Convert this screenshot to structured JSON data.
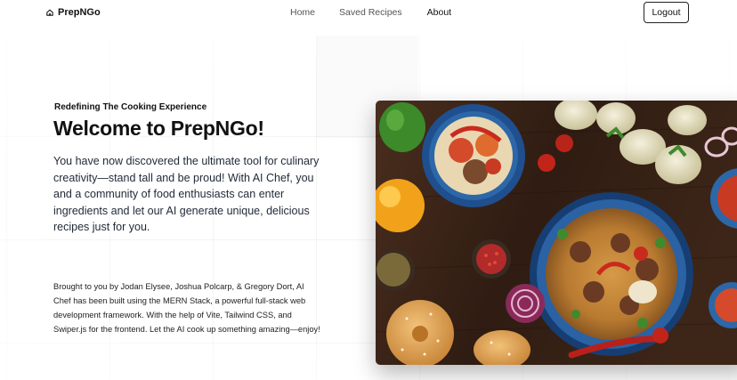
{
  "nav": {
    "brand": "PrepNGo",
    "links": [
      "Home",
      "Saved Recipes",
      "About"
    ],
    "logout_label": "Logout"
  },
  "hero": {
    "tagline": "Redefining The Cooking Experience",
    "title": "Welcome to PrepNGo!",
    "description": "You have now discovered the ultimate tool for culinary creativity—stand tall and be proud! With AI Chef, you and a community of food enthusiasts can enter ingredients and let our AI generate unique, delicious recipes just for you.",
    "credits": "Brought to you by Jodan Elysee, Joshua Polcarp, & Gregory Dort, AI Chef has been built using the MERN Stack, a powerful full-stack web development framework. With the help of Vite, Tailwind CSS, and Swiper.js for the frontend. Let the AI cook up something amazing—enjoy!"
  },
  "image": {
    "alt_icon": "food-photo",
    "colors": {
      "wood": "#3b2418",
      "bowl_blue": "#1f4f8f",
      "rice": "#c98a3a"
    }
  }
}
